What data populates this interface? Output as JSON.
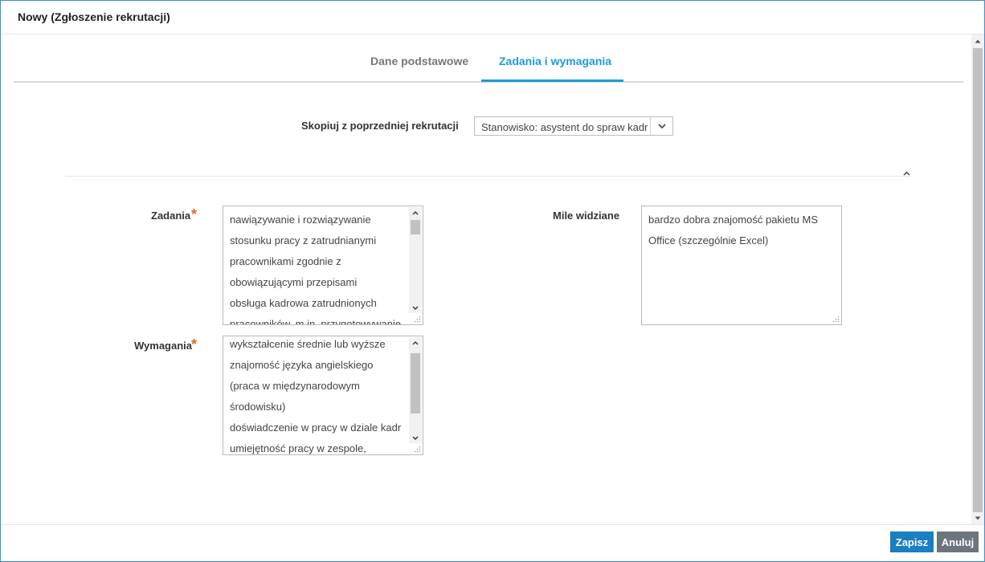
{
  "dialog": {
    "title": "Nowy (Zgłoszenie rekrutacji)"
  },
  "tabs": [
    {
      "label": "Dane podstawowe",
      "active": false
    },
    {
      "label": "Zadania i wymagania",
      "active": true
    }
  ],
  "copy": {
    "label": "Skopiuj z poprzedniej rekrutacji",
    "selected": "Stanowisko: asystent do spraw kadr"
  },
  "fields": {
    "tasks": {
      "label": "Zadania",
      "required_mark": "*",
      "lines": [
        "nawiązywanie i rozwiązywanie",
        "stosunku pracy z zatrudnianymi",
        "pracownikami zgodnie z",
        "obowiązującymi przepisami",
        "obsługa kadrowa zatrudnionych",
        "pracowników, m.in. przygotowywanie"
      ]
    },
    "nice_to_have": {
      "label": "Mile widziane",
      "lines": [
        "bardzo dobra znajomość pakietu MS",
        "Office (szczególnie Excel)"
      ]
    },
    "requirements": {
      "label": "Wymagania",
      "required_mark": "*",
      "lines": [
        "wykształcenie średnie lub wyższe",
        "znajomość języka angielskiego",
        "(praca w międzynarodowym",
        "środowisku)",
        "doświadczenie w pracy w dziale kadr",
        "umiejętność pracy w zespole,"
      ]
    }
  },
  "footer": {
    "save_label": "Zapisz",
    "cancel_label": "Anuluj"
  },
  "colors": {
    "accent": "#1f9bd7",
    "required": "#e06a1f",
    "save_button": "#1a7fc1",
    "cancel_button": "#6c757d"
  }
}
